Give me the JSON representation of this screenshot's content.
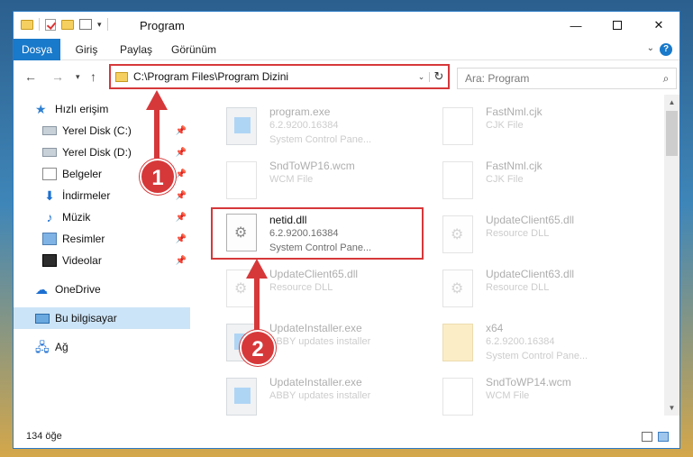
{
  "window": {
    "title": "Program",
    "controls": {
      "minimize": "—",
      "close": "✕"
    }
  },
  "quick_access_toolbar": {
    "dropdown": "▾"
  },
  "ribbon": {
    "tabs": [
      {
        "label": "Dosya",
        "active": true
      },
      {
        "label": "Giriş"
      },
      {
        "label": "Paylaş"
      },
      {
        "label": "Görünüm"
      }
    ],
    "expand": "⌄",
    "help": "?"
  },
  "navigation": {
    "back": "←",
    "forward": "→",
    "recent": "▾",
    "up": "↑",
    "address": "C:\\Program Files\\Program Dizini",
    "address_dropdown": "⌄",
    "refresh": "↻",
    "search_placeholder": "Ara: Program",
    "search_icon": "⌕"
  },
  "sidebar": {
    "items": [
      {
        "label": "Hızlı erişim",
        "icon": "star-icon"
      },
      {
        "label": "Yerel Disk (C:)",
        "icon": "disk-icon",
        "pinned": true
      },
      {
        "label": "Yerel Disk (D:)",
        "icon": "disk-icon",
        "pinned": true
      },
      {
        "label": "Belgeler",
        "icon": "documents-icon",
        "pinned": true
      },
      {
        "label": "İndirmeler",
        "icon": "download-icon",
        "pinned": true
      },
      {
        "label": "Müzik",
        "icon": "music-icon",
        "pinned": true
      },
      {
        "label": "Resimler",
        "icon": "pictures-icon",
        "pinned": true
      },
      {
        "label": "Videolar",
        "icon": "videos-icon",
        "pinned": true
      },
      {
        "label": "OneDrive",
        "icon": "cloud-icon"
      },
      {
        "label": "Bu bilgisayar",
        "icon": "computer-icon",
        "selected": true
      },
      {
        "label": "Ağ",
        "icon": "network-icon"
      }
    ],
    "pin_glyph": "📌",
    "star_glyph": "★",
    "down_glyph": "⬇",
    "music_glyph": "♪",
    "cloud_glyph": "☁",
    "net_glyph": "🖧"
  },
  "files": [
    {
      "name": "program.exe",
      "line2": "6.2.9200.16384",
      "line3": "System Control Pane...",
      "type": "exe",
      "faded": true
    },
    {
      "name": "FastNml.cjk",
      "line2": "CJK File",
      "line3": "",
      "type": "doc",
      "faded": true
    },
    {
      "name": "SndToWP16.wcm",
      "line2": "WCM File",
      "line3": "",
      "type": "doc",
      "faded": true
    },
    {
      "name": "FastNml.cjk",
      "line2": "CJK File",
      "line3": "",
      "type": "doc",
      "faded": true
    },
    {
      "name": "netid.dll",
      "line2": "6.2.9200.16384",
      "line3": "System Control Pane...",
      "type": "dll",
      "faded": false
    },
    {
      "name": "UpdateClient65.dll",
      "line2": "Resource DLL",
      "line3": "",
      "type": "dll",
      "faded": true
    },
    {
      "name": "UpdateClient65.dll",
      "line2": "Resource DLL",
      "line3": "",
      "type": "dll",
      "faded": true
    },
    {
      "name": "UpdateClient63.dll",
      "line2": "Resource DLL",
      "line3": "",
      "type": "dll",
      "faded": true
    },
    {
      "name": "UpdateInstaller.exe",
      "line2": "ABBY updates installer",
      "line3": "",
      "type": "exe",
      "faded": true
    },
    {
      "name": "x64",
      "line2": "6.2.9200.16384",
      "line3": "System Control Pane...",
      "type": "folder",
      "faded": true
    },
    {
      "name": "UpdateInstaller.exe",
      "line2": "ABBY updates installer",
      "line3": "",
      "type": "exe",
      "faded": true
    },
    {
      "name": "SndToWP14.wcm",
      "line2": "WCM File",
      "line3": "",
      "type": "doc",
      "faded": true
    }
  ],
  "status": {
    "item_count": "134 öğe"
  },
  "annotations": {
    "step1": "1",
    "step2": "2"
  },
  "scrollbar": {
    "up": "▲",
    "down": "▼"
  },
  "colors": {
    "accent": "#1979ca",
    "annotation_red": "#d6383a",
    "selected_bg": "#cce4f7"
  }
}
